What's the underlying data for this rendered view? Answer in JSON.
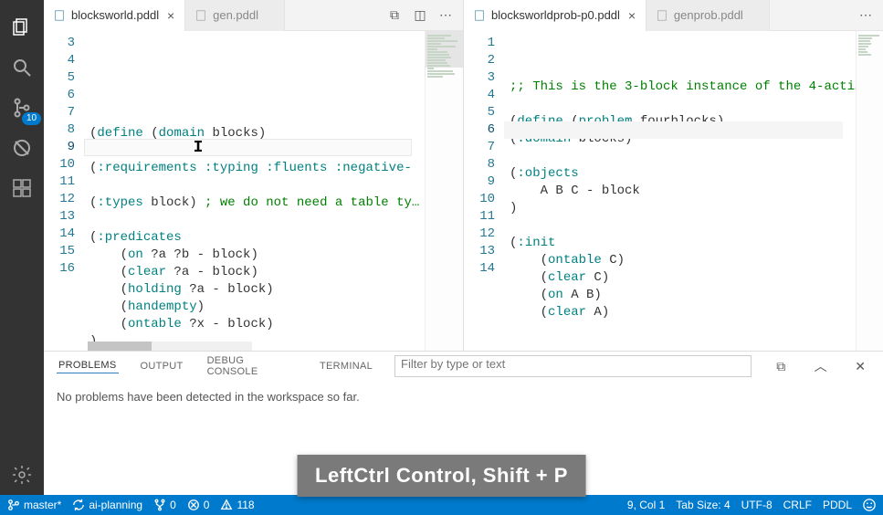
{
  "activity_bar": {
    "scm_badge": "10"
  },
  "left_editor": {
    "tabs": [
      {
        "label": "blocksworld.pddl",
        "active": true
      },
      {
        "label": "gen.pddl",
        "active": false
      }
    ],
    "line_numbers": [
      "3",
      "4",
      "5",
      "6",
      "7",
      "8",
      "9",
      "10",
      "11",
      "12",
      "13",
      "14",
      "15",
      "16"
    ],
    "current_line": "9",
    "segments": [
      [
        {
          "t": " ",
          "c": "tok-normal"
        }
      ],
      [
        {
          "t": "(",
          "c": "tok-normal"
        },
        {
          "t": "define",
          "c": "tok-keyword"
        },
        {
          "t": " (",
          "c": "tok-normal"
        },
        {
          "t": "domain",
          "c": "tok-keyword"
        },
        {
          "t": " blocks)",
          "c": "tok-normal"
        }
      ],
      [
        {
          "t": " ",
          "c": "tok-normal"
        }
      ],
      [
        {
          "t": "(",
          "c": "tok-normal"
        },
        {
          "t": ":requirements",
          "c": "tok-keyword"
        },
        {
          "t": " ",
          "c": "tok-normal"
        },
        {
          "t": ":typing",
          "c": "tok-keyword"
        },
        {
          "t": " ",
          "c": "tok-normal"
        },
        {
          "t": ":fluents",
          "c": "tok-keyword"
        },
        {
          "t": " ",
          "c": "tok-normal"
        },
        {
          "t": ":negative-",
          "c": "tok-keyword"
        }
      ],
      [
        {
          "t": " ",
          "c": "tok-normal"
        }
      ],
      [
        {
          "t": "(",
          "c": "tok-normal"
        },
        {
          "t": ":types",
          "c": "tok-keyword"
        },
        {
          "t": " block) ",
          "c": "tok-normal"
        },
        {
          "t": "; we do not need a table ty…",
          "c": "tok-comment"
        }
      ],
      [
        {
          "t": " ",
          "c": "tok-normal"
        }
      ],
      [
        {
          "t": "(",
          "c": "tok-normal"
        },
        {
          "t": ":predicates",
          "c": "tok-keyword"
        }
      ],
      [
        {
          "t": "    (",
          "c": "tok-normal"
        },
        {
          "t": "on",
          "c": "tok-keyword"
        },
        {
          "t": " ?a ?b - block)",
          "c": "tok-normal"
        }
      ],
      [
        {
          "t": "    (",
          "c": "tok-normal"
        },
        {
          "t": "clear",
          "c": "tok-keyword"
        },
        {
          "t": " ?a - block)",
          "c": "tok-normal"
        }
      ],
      [
        {
          "t": "    (",
          "c": "tok-normal"
        },
        {
          "t": "holding",
          "c": "tok-keyword"
        },
        {
          "t": " ?a - block)",
          "c": "tok-normal"
        }
      ],
      [
        {
          "t": "    (",
          "c": "tok-normal"
        },
        {
          "t": "handempty",
          "c": "tok-keyword"
        },
        {
          "t": ")",
          "c": "tok-normal"
        }
      ],
      [
        {
          "t": "    (",
          "c": "tok-normal"
        },
        {
          "t": "ontable",
          "c": "tok-keyword"
        },
        {
          "t": " ?x - block)",
          "c": "tok-normal"
        }
      ],
      [
        {
          "t": ")",
          "c": "tok-normal"
        }
      ]
    ]
  },
  "right_editor": {
    "tabs": [
      {
        "label": "blocksworldprob-p0.pddl",
        "active": true
      },
      {
        "label": "genprob.pddl",
        "active": false
      }
    ],
    "line_numbers": [
      "1",
      "2",
      "3",
      "4",
      "5",
      "6",
      "7",
      "8",
      "9",
      "10",
      "11",
      "12",
      "13",
      "14"
    ],
    "current_line": "6",
    "segments": [
      [
        {
          "t": ";; This is the 3-block instance of the 4-acti…",
          "c": "tok-comment"
        }
      ],
      [
        {
          "t": " ",
          "c": "tok-normal"
        }
      ],
      [
        {
          "t": "(",
          "c": "tok-normal"
        },
        {
          "t": "define",
          "c": "tok-keyword"
        },
        {
          "t": " (",
          "c": "tok-normal"
        },
        {
          "t": "problem",
          "c": "tok-keyword"
        },
        {
          "t": " fourblocks)",
          "c": "tok-normal"
        }
      ],
      [
        {
          "t": "(",
          "c": "tok-normal"
        },
        {
          "t": ":domain",
          "c": "tok-keyword"
        },
        {
          "t": " blocks)",
          "c": "tok-normal"
        }
      ],
      [
        {
          "t": " ",
          "c": "tok-normal"
        }
      ],
      [
        {
          "t": "(",
          "c": "tok-normal"
        },
        {
          "t": ":objects",
          "c": "tok-keyword"
        }
      ],
      [
        {
          "t": "    A B C - block",
          "c": "tok-normal"
        }
      ],
      [
        {
          "t": ")",
          "c": "tok-normal"
        }
      ],
      [
        {
          "t": " ",
          "c": "tok-normal"
        }
      ],
      [
        {
          "t": "(",
          "c": "tok-normal"
        },
        {
          "t": ":init",
          "c": "tok-keyword"
        }
      ],
      [
        {
          "t": "    (",
          "c": "tok-normal"
        },
        {
          "t": "ontable",
          "c": "tok-keyword"
        },
        {
          "t": " C)",
          "c": "tok-normal"
        }
      ],
      [
        {
          "t": "    (",
          "c": "tok-normal"
        },
        {
          "t": "clear",
          "c": "tok-keyword"
        },
        {
          "t": " C)",
          "c": "tok-normal"
        }
      ],
      [
        {
          "t": "    (",
          "c": "tok-normal"
        },
        {
          "t": "on",
          "c": "tok-keyword"
        },
        {
          "t": " A B)",
          "c": "tok-normal"
        }
      ],
      [
        {
          "t": "    (",
          "c": "tok-normal"
        },
        {
          "t": "clear",
          "c": "tok-keyword"
        },
        {
          "t": " A)",
          "c": "tok-normal"
        }
      ]
    ]
  },
  "panel": {
    "tabs": [
      "PROBLEMS",
      "OUTPUT",
      "DEBUG CONSOLE",
      "TERMINAL"
    ],
    "active_tab": 0,
    "filter_placeholder": "Filter by type or text",
    "message": "No problems have been detected in the workspace so far."
  },
  "status_bar": {
    "branch": "master*",
    "sync": "ai-planning",
    "forks": "0",
    "errors": "0",
    "warnings": "118",
    "cursor": "9, Col 1",
    "tab_size": "Tab Size: 4",
    "encoding": "UTF-8",
    "eol": "CRLF",
    "language": "PDDL"
  },
  "key_overlay": "LeftCtrl  Control, Shift + P"
}
